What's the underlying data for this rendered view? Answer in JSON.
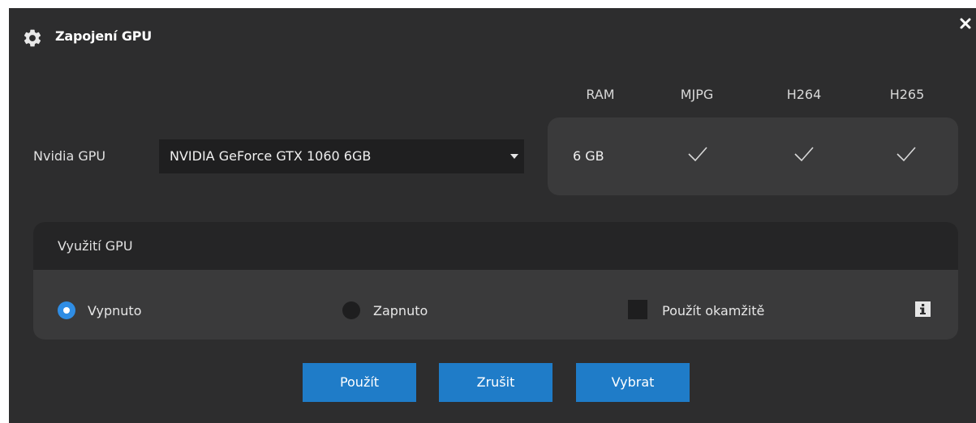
{
  "window": {
    "title": "Zapojení GPU"
  },
  "gpu": {
    "label": "Nvidia GPU",
    "selected": "NVIDIA GeForce GTX 1060 6GB"
  },
  "capabilities": {
    "headers": [
      "RAM",
      "MJPG",
      "H264",
      "H265"
    ],
    "ram": "6 GB",
    "mjpg_supported": true,
    "h264_supported": true,
    "h265_supported": true
  },
  "usage": {
    "title": "Využití GPU",
    "options": [
      {
        "label": "Vypnuto",
        "selected": true
      },
      {
        "label": "Zapnuto",
        "selected": false
      }
    ],
    "apply_immediately": {
      "label": "Použít okamžitě",
      "checked": false
    }
  },
  "buttons": {
    "apply": "Použít",
    "cancel": "Zrušit",
    "select": "Vybrat"
  },
  "colors": {
    "background": "#2d2d2e",
    "panel": "#3a3a3b",
    "panel_header": "#252526",
    "accent": "#1f7cc8",
    "radio_selected": "#2f8de4"
  },
  "icons": [
    "gear-icon",
    "close-icon",
    "dropdown-arrow-icon",
    "check-icon",
    "info-icon"
  ]
}
